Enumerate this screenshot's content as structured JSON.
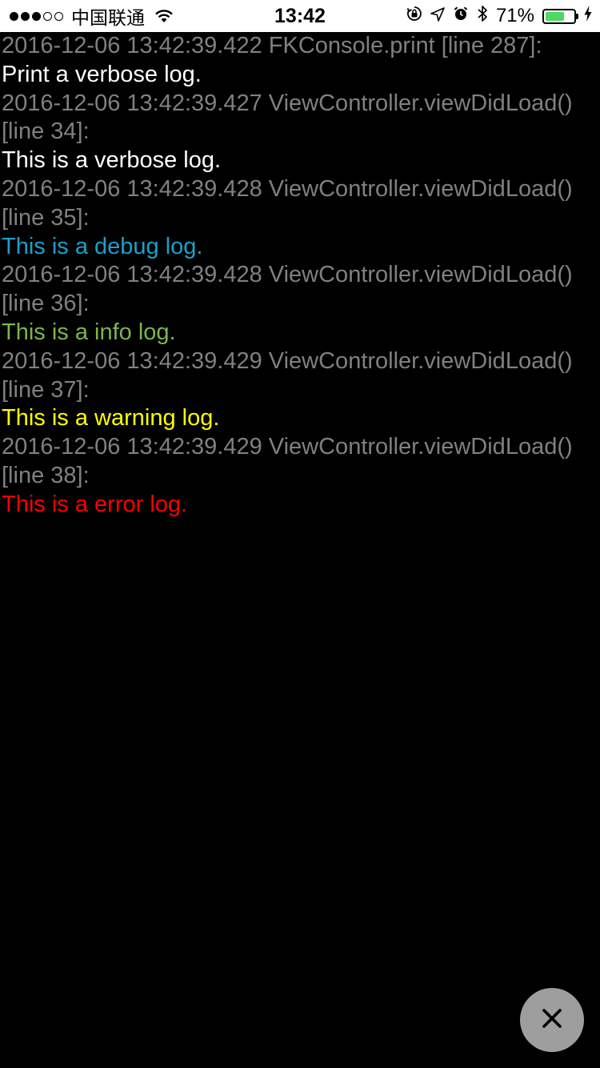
{
  "status_bar": {
    "carrier": "中国联通",
    "time": "13:42",
    "battery_percent": "71%",
    "battery_level": 0.71,
    "battery_color": "#4cd964",
    "icons": [
      "signal-dots-icon",
      "wifi-icon",
      "orientation-lock-icon",
      "location-arrow-icon",
      "alarm-icon",
      "bluetooth-icon",
      "battery-icon",
      "charging-bolt-icon"
    ]
  },
  "logs": [
    {
      "header": "2016-12-06 13:42:39.422 FKConsole.print [line 287]:",
      "message": "Print a verbose log.",
      "level": "verbose",
      "color": "#ffffff"
    },
    {
      "header": "2016-12-06 13:42:39.427 ViewController.viewDidLoad() [line 34]:",
      "message": "This is a verbose log.",
      "level": "verbose",
      "color": "#ffffff"
    },
    {
      "header": "2016-12-06 13:42:39.428 ViewController.viewDidLoad() [line 35]:",
      "message": "This is a debug log.",
      "level": "debug",
      "color": "#1d9fcb"
    },
    {
      "header": "2016-12-06 13:42:39.428 ViewController.viewDidLoad() [line 36]:",
      "message": "This is a info log.",
      "level": "info",
      "color": "#7cb64a"
    },
    {
      "header": "2016-12-06 13:42:39.429 ViewController.viewDidLoad() [line 37]:",
      "message": "This is a warning log.",
      "level": "warning",
      "color": "#fffe00"
    },
    {
      "header": "2016-12-06 13:42:39.429 ViewController.viewDidLoad() [line 38]:",
      "message": "This is a error log.",
      "level": "error",
      "color": "#fe0000"
    }
  ],
  "close_button": {
    "icon": "close-icon",
    "background": "#9e9e9e"
  }
}
